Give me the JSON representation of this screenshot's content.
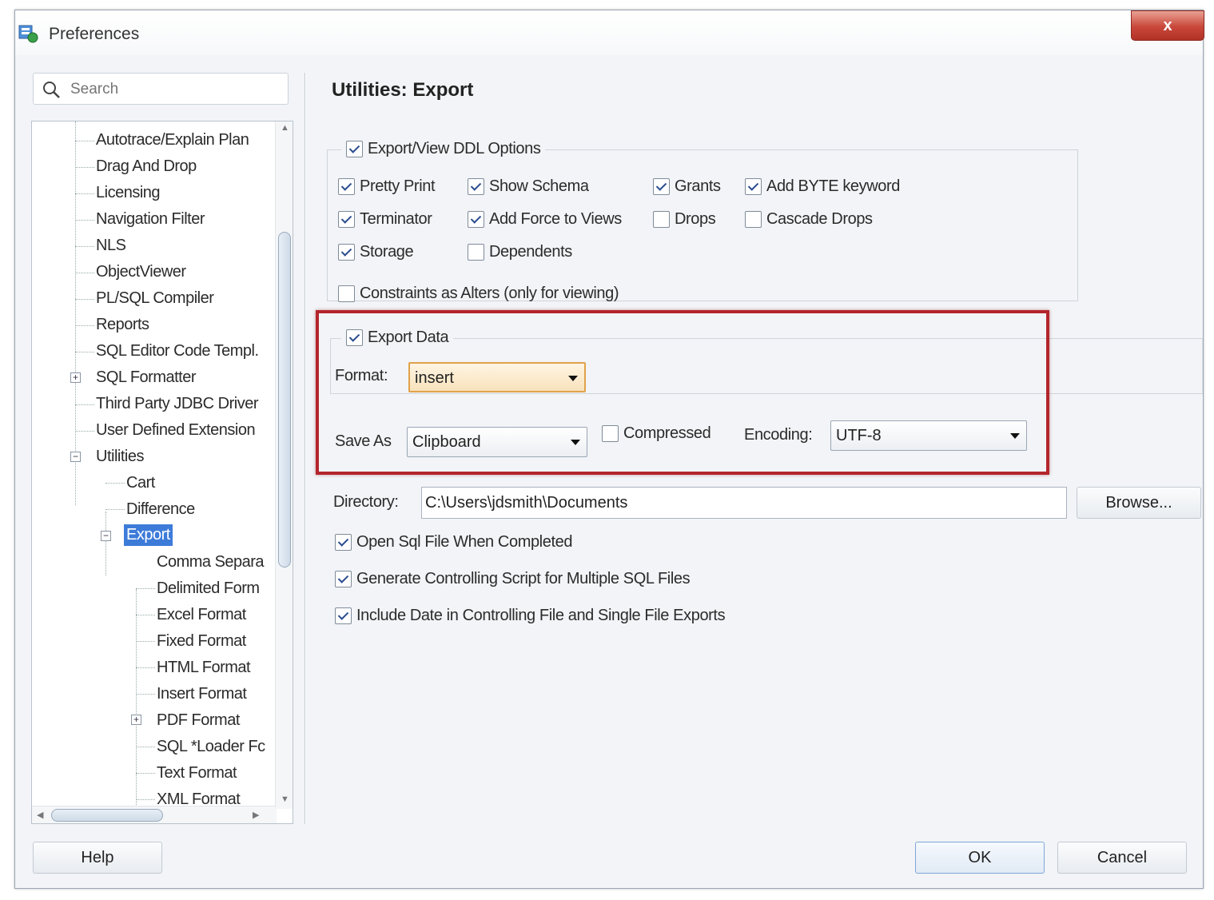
{
  "window": {
    "title": "Preferences",
    "close_label": "x"
  },
  "search": {
    "placeholder": "Search"
  },
  "tree": {
    "items": [
      {
        "label": "Autotrace/Explain Plan"
      },
      {
        "label": "Drag And Drop"
      },
      {
        "label": "Licensing"
      },
      {
        "label": "Navigation Filter"
      },
      {
        "label": "NLS"
      },
      {
        "label": "ObjectViewer"
      },
      {
        "label": "PL/SQL Compiler"
      },
      {
        "label": "Reports"
      },
      {
        "label": "SQL Editor Code Templ."
      },
      {
        "label": "SQL Formatter"
      },
      {
        "label": "Third Party JDBC Driver"
      },
      {
        "label": "User Defined Extension"
      },
      {
        "label": "Utilities"
      },
      {
        "label": "Cart"
      },
      {
        "label": "Difference"
      },
      {
        "label": "Export"
      },
      {
        "label": "Comma Separa"
      },
      {
        "label": "Delimited Form"
      },
      {
        "label": "Excel Format"
      },
      {
        "label": "Fixed Format"
      },
      {
        "label": "HTML Format"
      },
      {
        "label": "Insert Format"
      },
      {
        "label": "PDF Format"
      },
      {
        "label": "SQL *Loader Fc"
      },
      {
        "label": "Text Format"
      },
      {
        "label": "XML Format"
      }
    ],
    "expander_plus": "+",
    "expander_minus": "−"
  },
  "page": {
    "title": "Utilities: Export"
  },
  "ddl": {
    "group_label": "Export/View DDL Options",
    "group_checked": true,
    "options": [
      {
        "label": "Pretty Print",
        "checked": true
      },
      {
        "label": "Show Schema",
        "checked": true
      },
      {
        "label": "Grants",
        "checked": true
      },
      {
        "label": "Add BYTE keyword",
        "checked": true
      },
      {
        "label": "Terminator",
        "checked": true
      },
      {
        "label": "Add Force to Views",
        "checked": true
      },
      {
        "label": "Drops",
        "checked": false
      },
      {
        "label": "Cascade Drops",
        "checked": false
      },
      {
        "label": "Storage",
        "checked": true
      },
      {
        "label": "Dependents",
        "checked": false
      },
      {
        "label": "Constraints as Alters (only for viewing)",
        "checked": false
      }
    ]
  },
  "data": {
    "group_label": "Export Data",
    "group_checked": true,
    "format_label": "Format:",
    "format_value": "insert",
    "save_as_label": "Save As",
    "save_as_value": "Clipboard",
    "compressed_label": "Compressed",
    "compressed_checked": false,
    "encoding_label": "Encoding:",
    "encoding_value": "UTF-8"
  },
  "directory": {
    "label": "Directory:",
    "value": "C:\\Users\\jdsmith\\Documents",
    "browse_label": "Browse..."
  },
  "options": [
    {
      "label": "Open Sql File When Completed",
      "checked": true
    },
    {
      "label": "Generate Controlling Script for Multiple SQL Files",
      "checked": true
    },
    {
      "label": "Include Date in Controlling File and Single File Exports",
      "checked": true
    }
  ],
  "buttons": {
    "help": "Help",
    "ok": "OK",
    "cancel": "Cancel"
  },
  "colors": {
    "highlight": "#b3252b",
    "selection": "#3d7bd9",
    "close": "#c8473a"
  }
}
